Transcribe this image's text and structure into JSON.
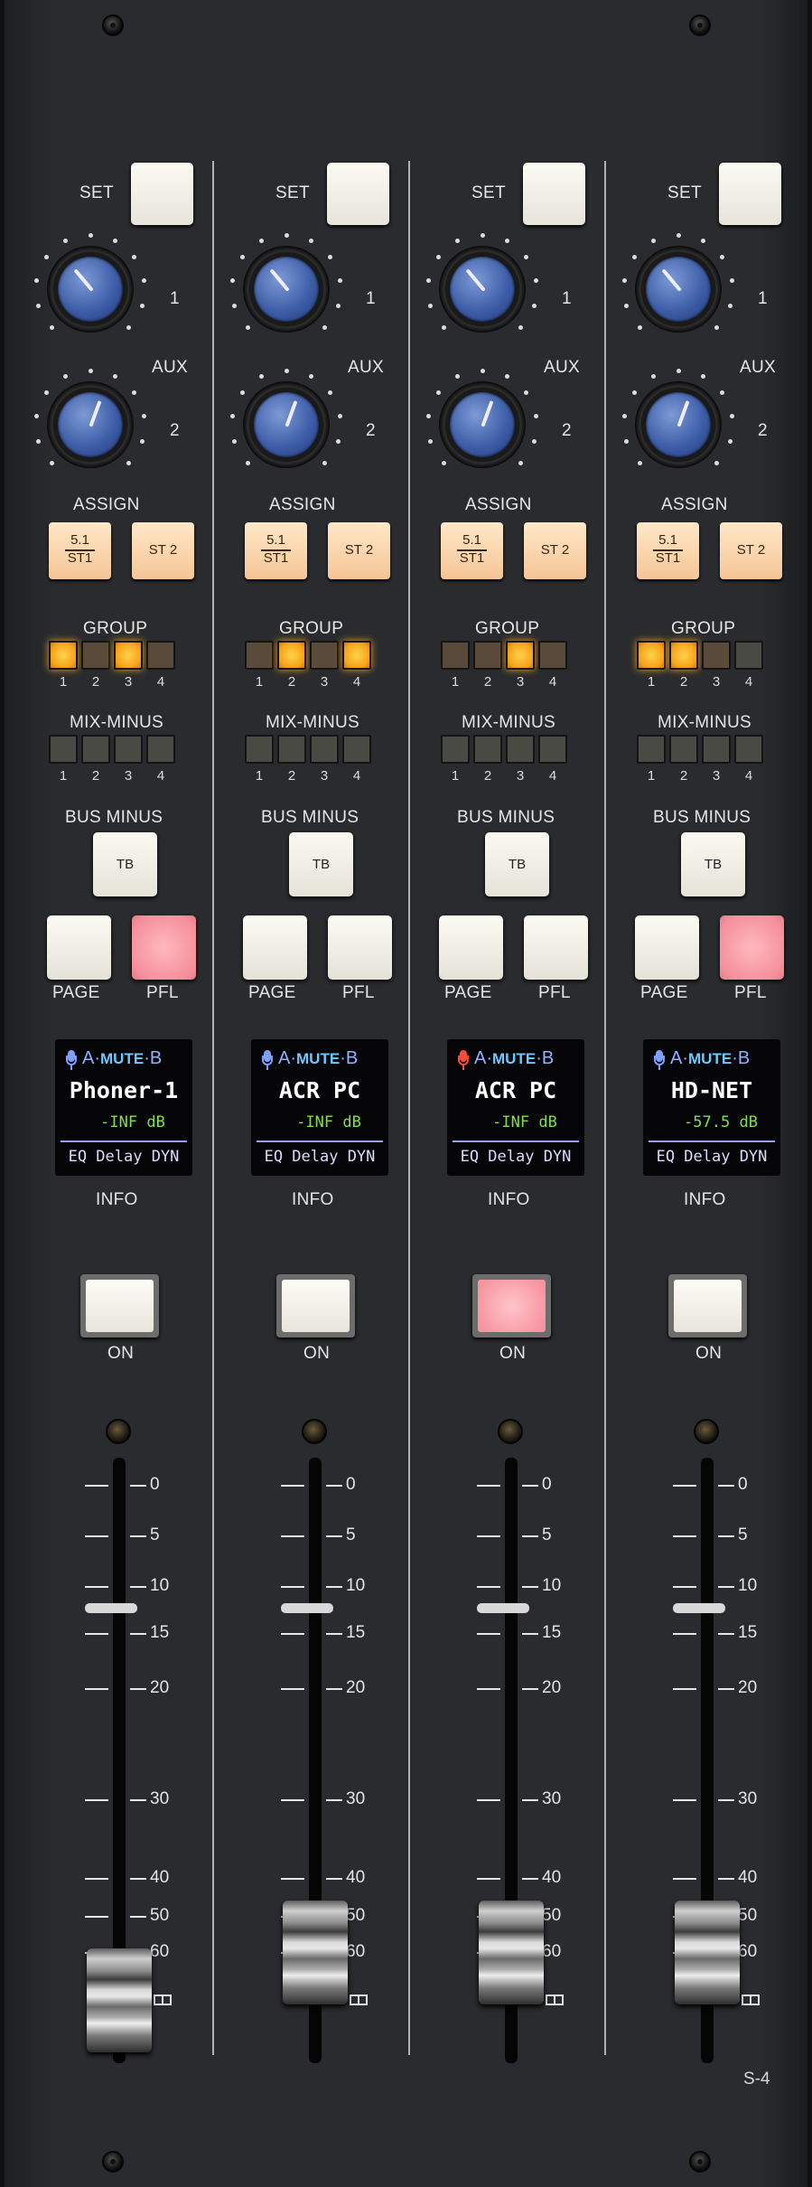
{
  "model_label": "S-4",
  "labels": {
    "set": "SET",
    "aux": "AUX",
    "aux_1": "1",
    "aux_2": "2",
    "assign": "ASSIGN",
    "assign_51_top": "5.1",
    "assign_51_bottom": "ST1",
    "assign_st2": "ST 2",
    "group": "GROUP",
    "mix_minus": "MIX-MINUS",
    "bus_minus": "BUS MINUS",
    "tb": "TB",
    "page": "PAGE",
    "pfl": "PFL",
    "info": "INFO",
    "on": "ON",
    "led_numbers": [
      "1",
      "2",
      "3",
      "4"
    ],
    "scale": [
      "0",
      "5",
      "10",
      "15",
      "20",
      "30",
      "40",
      "50",
      "60"
    ],
    "oled_a": "A",
    "oled_mute": "MUTE",
    "oled_b": "B",
    "oled_dot": "·"
  },
  "colors": {
    "mic_blue": "#7f9fff",
    "mic_red": "#ff4a3a",
    "led_on": "#f6a21a",
    "pfl_lit": "#f58e9a",
    "knob_blue": "#3e5ea8",
    "level_green": "#7fe04a"
  },
  "strips": [
    {
      "name": "Phoner-1",
      "level": "-INF dB",
      "fx": "EQ Delay DYN",
      "mic_state": "normal",
      "group_leds": [
        "on",
        "dim",
        "on",
        "dim"
      ],
      "pfl_on": true,
      "channel_on": false,
      "fader_position_db": "∞"
    },
    {
      "name": "ACR PC",
      "level": "-INF dB",
      "fx": "EQ Delay DYN",
      "mic_state": "normal",
      "group_leds": [
        "dim",
        "on",
        "dim",
        "on"
      ],
      "pfl_on": false,
      "channel_on": false,
      "fader_position_db": "60"
    },
    {
      "name": "ACR PC",
      "level": "-INF dB",
      "fx": "EQ Delay DYN",
      "mic_state": "live",
      "group_leds": [
        "dim",
        "dim",
        "on",
        "dim"
      ],
      "pfl_on": false,
      "channel_on": true,
      "fader_position_db": "60"
    },
    {
      "name": "HD-NET",
      "level": "-57.5 dB",
      "fx": "EQ Delay DYN",
      "mic_state": "normal",
      "group_leds": [
        "on",
        "on",
        "dim",
        "mm"
      ],
      "pfl_on": true,
      "channel_on": false,
      "fader_position_db": "60"
    }
  ]
}
